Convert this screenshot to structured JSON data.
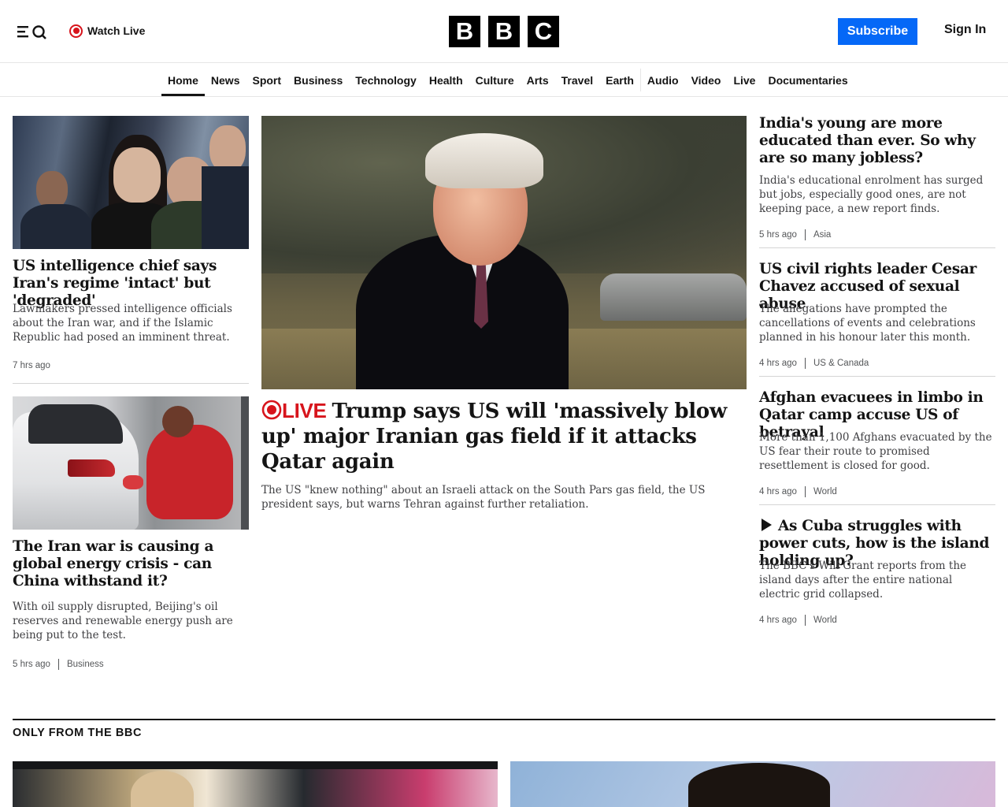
{
  "header": {
    "watch_live": "Watch Live",
    "logo_letters": [
      "B",
      "B",
      "C"
    ],
    "subscribe": "Subscribe",
    "sign_in": "Sign In",
    "accent_color": "#0568f7",
    "live_color": "#d7141c"
  },
  "nav": {
    "items": [
      "Home",
      "News",
      "Sport",
      "Business",
      "Technology",
      "Health",
      "Culture",
      "Arts",
      "Travel",
      "Earth",
      "Audio",
      "Video",
      "Live",
      "Documentaries"
    ],
    "active": "Home"
  },
  "left_column": {
    "stories": [
      {
        "image": "intelligence-hearing-photo",
        "headline": "US intelligence chief says Iran's regime 'intact' but 'degraded'",
        "summary": "Lawmakers pressed intelligence officials about the Iran war, and if the Islamic Republic had posed an imminent threat.",
        "time": "7 hrs ago",
        "category": ""
      },
      {
        "image": "fuel-station-photo",
        "headline": "The Iran war is causing a global energy crisis - can China withstand it?",
        "summary": "With oil supply disrupted, Beijing's oil reserves and renewable energy push are being put to the test.",
        "time": "5 hrs ago",
        "category": "Business"
      }
    ]
  },
  "lead_story": {
    "image": "trump-photo",
    "live_label": "LIVE",
    "headline": "Trump says US will 'massively blow up' major Iranian gas field if it attacks Qatar again",
    "summary": "The US \"knew nothing\" about an Israeli attack on the South Pars gas field, the US president says, but warns Tehran against further retaliation."
  },
  "right_column": {
    "stories": [
      {
        "headline": "India's young are more educated than ever. So why are so many jobless?",
        "summary": "India's educational enrolment has surged but jobs, especially good ones, are not keeping pace, a new report finds.",
        "time": "5 hrs ago",
        "category": "Asia",
        "video": false
      },
      {
        "headline": "US civil rights leader Cesar Chavez accused of sexual abuse",
        "summary": "The allegations have prompted the cancellations of events and celebrations planned in his honour later this month.",
        "time": "4 hrs ago",
        "category": "US & Canada",
        "video": false
      },
      {
        "headline": "Afghan evacuees in limbo in Qatar camp accuse US of betrayal",
        "summary": "More than 1,100 Afghans evacuated by the US fear their route to promised resettlement is closed for good.",
        "time": "4 hrs ago",
        "category": "World",
        "video": false
      },
      {
        "headline": "As Cuba struggles with power cuts, how is the island holding up?",
        "summary": "The BBC's Will Grant reports from the island days after the entire national electric grid collapsed.",
        "time": "4 hrs ago",
        "category": "World",
        "video": true
      }
    ]
  },
  "only_from_bbc": {
    "title": "ONLY FROM THE BBC"
  }
}
